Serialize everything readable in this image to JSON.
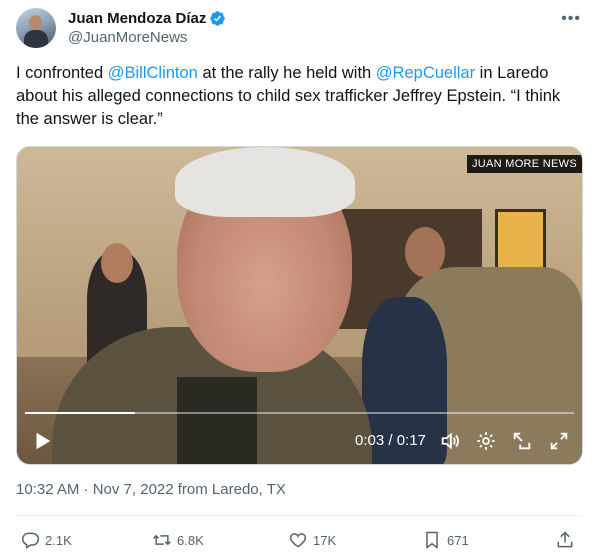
{
  "author": {
    "name": "Juan Mendoza Díaz",
    "handle": "@JuanMoreNews",
    "verified_icon": "verified-badge-icon"
  },
  "more_icon": "more-options-icon",
  "tweet": {
    "segments": [
      {
        "text": "I confronted ",
        "mention": false
      },
      {
        "text": "@BillClinton",
        "mention": true
      },
      {
        "text": " at the rally he held with ",
        "mention": false
      },
      {
        "text": "@RepCuellar",
        "mention": true
      },
      {
        "text": " in Laredo about his alleged connections to child sex trafficker Jeffrey Epstein. “I think the answer is clear.”",
        "mention": false
      }
    ]
  },
  "video": {
    "watermark": "JUAN MORE NEWS",
    "timecode": "0:03 / 0:17",
    "progress": 0.2,
    "controls": [
      "play-icon",
      "volume-icon",
      "settings-icon",
      "popout-icon",
      "fullscreen-icon"
    ]
  },
  "meta": {
    "timestamp": "10:32 AM · Nov 7, 2022 from Laredo, TX"
  },
  "actions": {
    "replies": "2.1K",
    "reposts": "6.8K",
    "likes": "17K",
    "bookmarks": "671"
  },
  "colors": {
    "accent": "#1d9bf0",
    "muted": "#536471",
    "text": "#0f1419"
  }
}
